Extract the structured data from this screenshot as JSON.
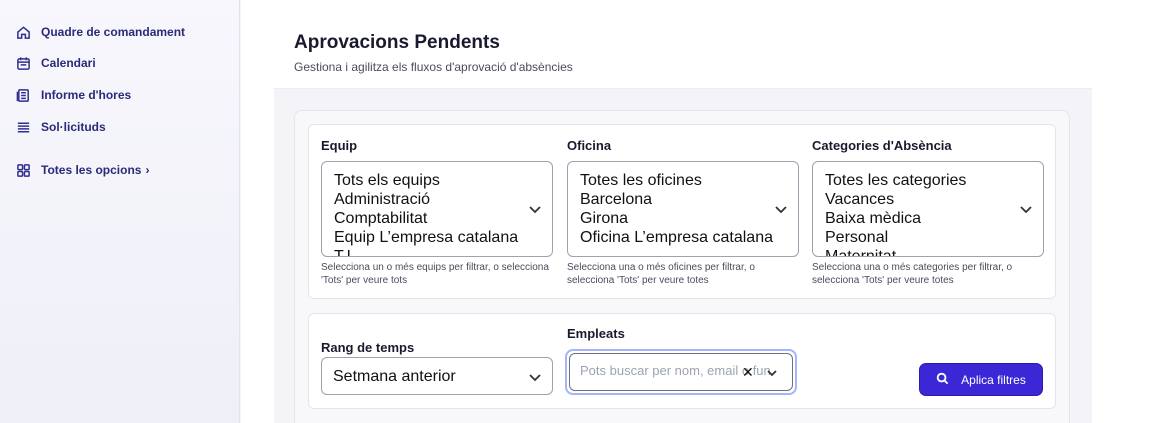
{
  "sidebar": {
    "items": [
      {
        "label": "Quadre de comandament",
        "icon": "home-icon"
      },
      {
        "label": "Calendari",
        "icon": "calendar-icon"
      },
      {
        "label": "Informe d'hores",
        "icon": "report-icon"
      },
      {
        "label": "Sol·licituds",
        "icon": "list-icon"
      }
    ],
    "all_options": {
      "label": "Totes les opcions",
      "icon": "grid-icon",
      "chevron": "›"
    }
  },
  "header": {
    "title": "Aprovacions Pendents",
    "subtitle": "Gestiona i agilitza els fluxos d'aprovació d'absències"
  },
  "filters": {
    "team": {
      "label": "Equip",
      "options": [
        "Tots els equips",
        "Administració",
        "Comptabilitat",
        "Equip L’empresa catalana",
        "T.I."
      ],
      "helper": "Selecciona un o més equips per filtrar, o selecciona 'Tots' per veure tots"
    },
    "office": {
      "label": "Oficina",
      "options": [
        "Totes les oficines",
        "Barcelona",
        "Girona",
        "Oficina L’empresa catalana"
      ],
      "helper": "Selecciona una o més oficines per filtrar, o selecciona 'Tots' per veure totes"
    },
    "category": {
      "label": "Categories d'Absència",
      "options": [
        "Totes les categories",
        "Vacances",
        "Baixa mèdica",
        "Personal",
        "Maternitat"
      ],
      "helper": "Selecciona una o més categories per filtrar, o selecciona 'Tots' per veure totes"
    },
    "time_range": {
      "label": "Rang de temps",
      "value": "Setmana anterior"
    },
    "employees": {
      "label": "Empleats",
      "placeholder": "Pots buscar per nom, email o fun",
      "clear": "✕"
    },
    "apply_label": "Aplica filtres"
  },
  "colors": {
    "accent": "#3b27d6",
    "nav_text": "#2a2a7a"
  }
}
